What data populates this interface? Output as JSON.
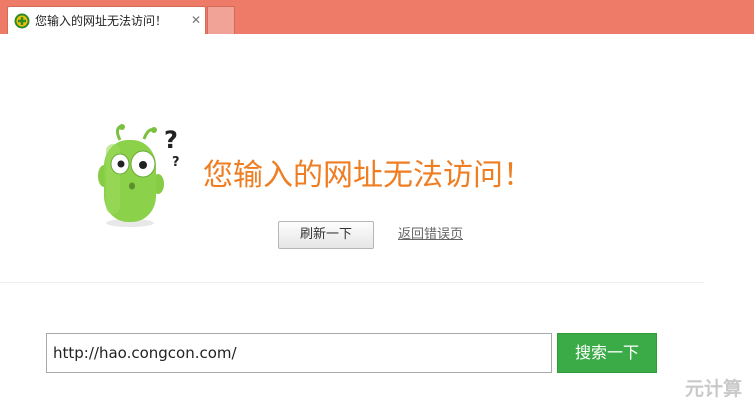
{
  "tab": {
    "title": "您输入的网址无法访问！",
    "close": "✕"
  },
  "error": {
    "title": "您输入的网址无法访问！",
    "refresh_label": "刷新一下",
    "back_link": "返回错误页"
  },
  "search": {
    "value": "http://hao.congcon.com/",
    "button_label": "搜索一下"
  },
  "watermark": "元计算",
  "colors": {
    "tabbar": "#ed7b67",
    "title": "#ef7d22",
    "search_button": "#3bab48",
    "mascot": "#8bd14a"
  }
}
